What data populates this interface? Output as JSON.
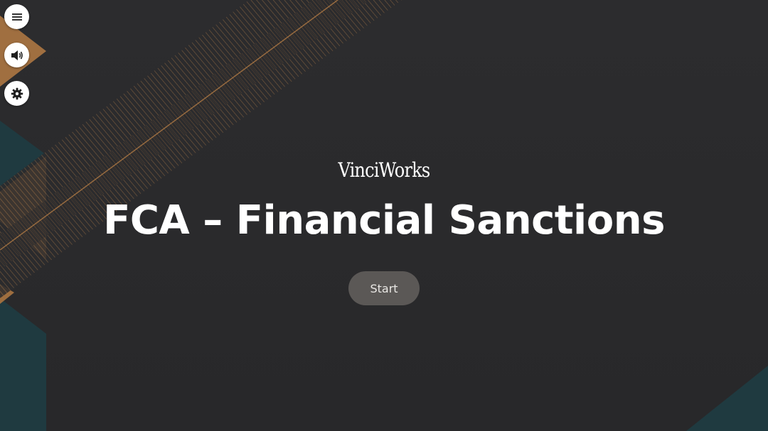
{
  "brand": {
    "logo_text": "VinciWorks"
  },
  "course": {
    "title": "FCA – Financial Sanctions"
  },
  "actions": {
    "start_label": "Start"
  },
  "sidebar": {
    "buttons": [
      {
        "icon": "menu-icon"
      },
      {
        "icon": "speaker-icon"
      },
      {
        "icon": "gear-icon"
      }
    ]
  },
  "colors": {
    "background": "#2a2a2c",
    "accent_copper": "#b07a45",
    "accent_teal": "#203a40",
    "button": "#5b5856",
    "text": "#ffffff"
  }
}
